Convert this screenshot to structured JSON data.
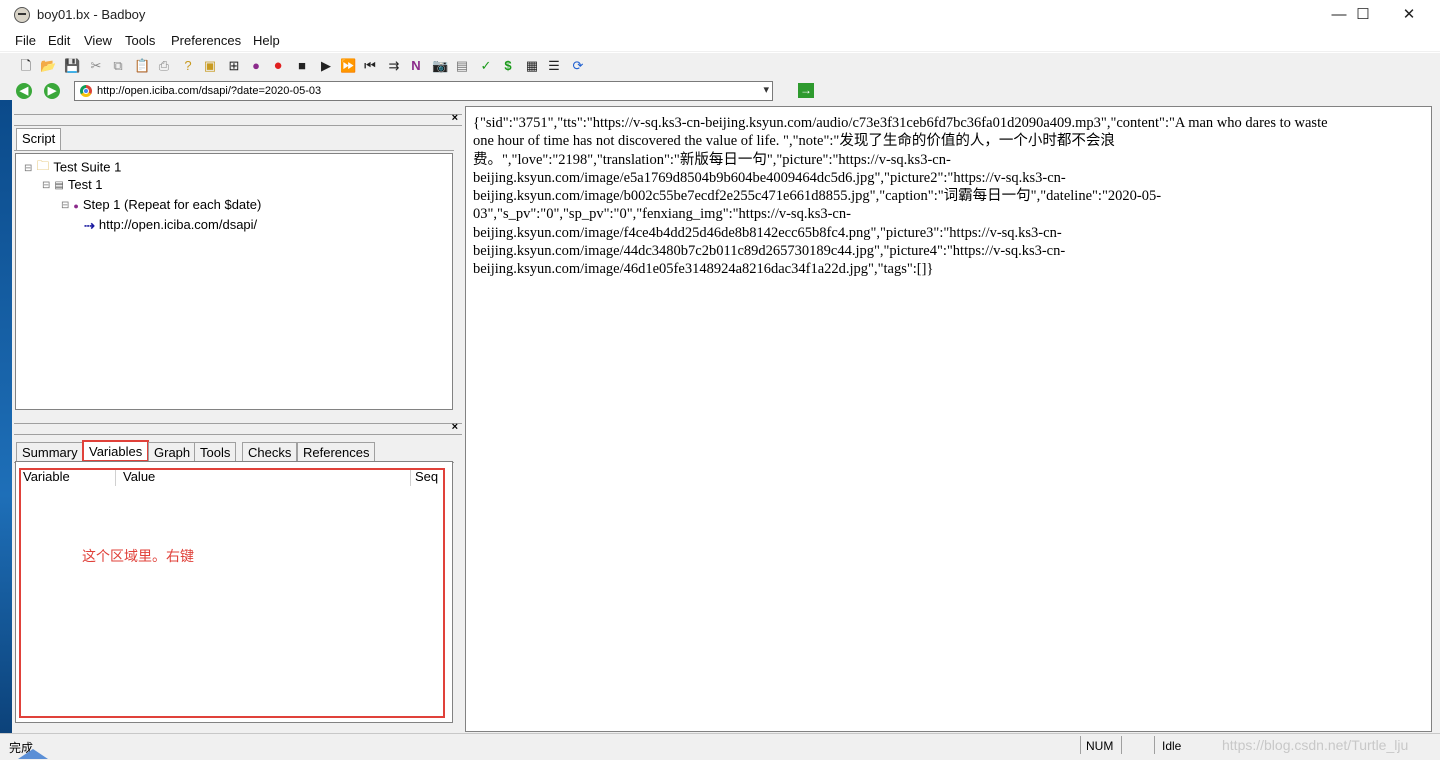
{
  "window": {
    "title": "boy01.bx - Badboy",
    "min": "—",
    "max": "☐",
    "close": "✕"
  },
  "menu": [
    "File",
    "Edit",
    "View",
    "Tools",
    "Preferences",
    "Help"
  ],
  "address": {
    "url": "http://open.iciba.com/dsapi/?date=2020-05-03",
    "dropdown": "▾",
    "go": "→"
  },
  "script_panel": {
    "tab": "Script",
    "tree": {
      "suite": "Test Suite 1",
      "test": "Test 1",
      "step": "Step 1 (Repeat for each $date)",
      "request": "http://open.iciba.com/dsapi/"
    }
  },
  "bottom_panel": {
    "tabs": [
      "Summary",
      "Variables",
      "Graph",
      "Tools",
      "Checks",
      "References"
    ],
    "active_tab": "Variables",
    "columns": {
      "variable": "Variable",
      "value": "Value",
      "seq": "Seq"
    },
    "note": "这个区域里。右键"
  },
  "response_lines": [
    "{\"sid\":\"3751\",\"tts\":\"https://v-sq.ks3-cn-beijing.ksyun.com/audio/c73e3f31ceb6fd7bc36fa01d2090a409.mp3\",\"content\":\"A man who dares to waste",
    "one hour of time has not discovered the value of life. \",\"note\":\"发现了生命的价值的人，一个小时都不会浪",
    "费。\",\"love\":\"2198\",\"translation\":\"新版每日一句\",\"picture\":\"https://v-sq.ks3-cn-",
    "beijing.ksyun.com/image/e5a1769d8504b9b604be4009464dc5d6.jpg\",\"picture2\":\"https://v-sq.ks3-cn-",
    "beijing.ksyun.com/image/b002c55be7ecdf2e255c471e661d8855.jpg\",\"caption\":\"词霸每日一句\",\"dateline\":\"2020-05-",
    "03\",\"s_pv\":\"0\",\"sp_pv\":\"0\",\"fenxiang_img\":\"https://v-sq.ks3-cn-",
    "beijing.ksyun.com/image/f4ce4b4dd25d46de8b8142ecc65b8fc4.png\",\"picture3\":\"https://v-sq.ks3-cn-",
    "beijing.ksyun.com/image/44dc3480b7c2b011c89d265730189c44.jpg\",\"picture4\":\"https://v-sq.ks3-cn-",
    "beijing.ksyun.com/image/46d1e05fe3148924a8216dac34f1a22d.jpg\",\"tags\":[]}"
  ],
  "status": {
    "left": "完成",
    "num": "NUM",
    "state": "Idle",
    "watermark": "https://blog.csdn.net/Turtle_lju"
  },
  "colors": {
    "highlight": "#e0413a",
    "go": "#2e9a2e"
  }
}
